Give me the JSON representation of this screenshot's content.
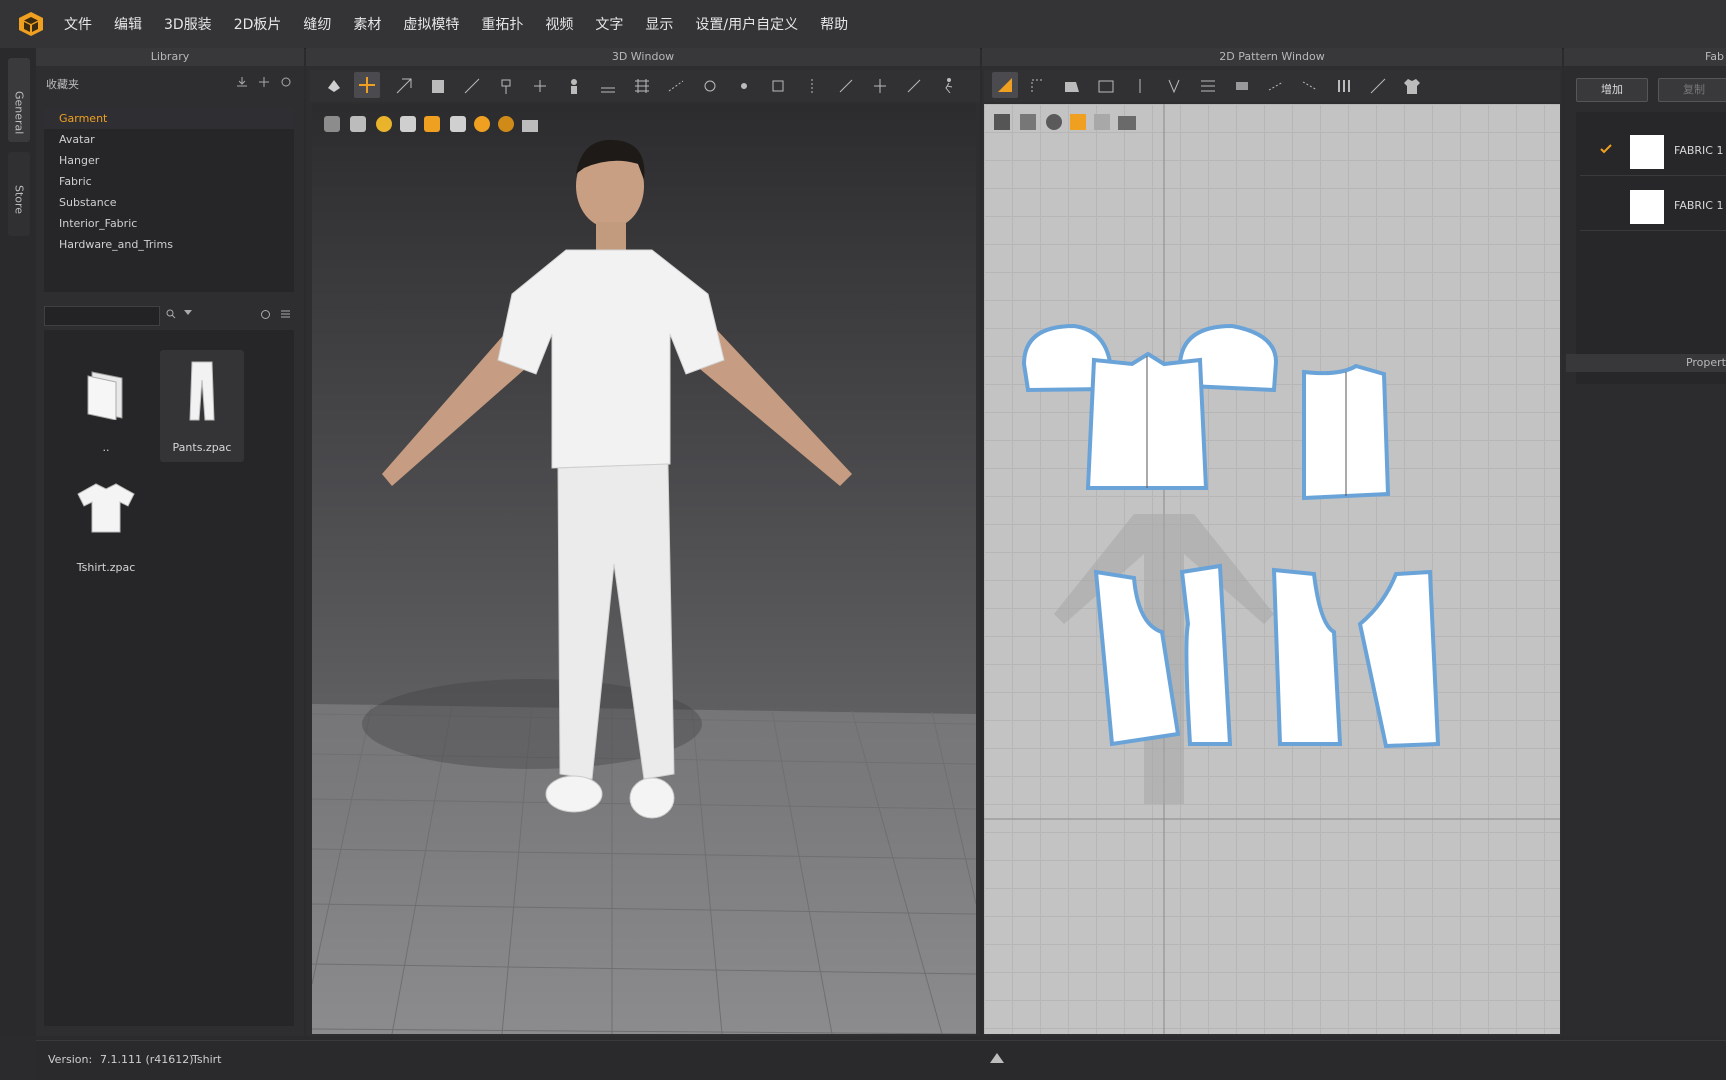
{
  "menu": {
    "items": [
      "文件",
      "编辑",
      "3D服装",
      "2D板片",
      "缝纫",
      "素材",
      "虚拟模特",
      "重拓扑",
      "视频",
      "文字",
      "显示",
      "设置/用户自定义",
      "帮助"
    ]
  },
  "side_tabs": {
    "general": "General",
    "store": "Store"
  },
  "library": {
    "title": "Library",
    "favorites_label": "收藏夹",
    "tree": [
      "Garment",
      "Avatar",
      "Hanger",
      "Fabric",
      "Substance",
      "Interior_Fabric",
      "Hardware_and_Trims"
    ],
    "selected": "Garment",
    "search_value": "",
    "files": [
      {
        "name": "..",
        "icon": "folder-icon"
      },
      {
        "name": "Pants.zpac",
        "icon": "pants-icon"
      },
      {
        "name": "Tshirt.zpac",
        "icon": "tshirt-icon"
      }
    ]
  },
  "window3d": {
    "title": "3D Window"
  },
  "window2d": {
    "title": "2D Pattern Window"
  },
  "right_panel": {
    "title": "Fab",
    "add_button": "增加",
    "second_button": "复制",
    "fabrics": [
      {
        "name": "FABRIC 1",
        "checked": true
      },
      {
        "name": "FABRIC 1",
        "checked": false
      }
    ],
    "property_title": "Propert"
  },
  "status": {
    "version_label": "Version:",
    "version_value": "7.1.111 (r41612)",
    "file_name": "Tshirt"
  },
  "colors": {
    "accent": "#f0a020",
    "pattern_outline": "#6aa3d8",
    "viewport_2d": "#c3c3c3"
  }
}
